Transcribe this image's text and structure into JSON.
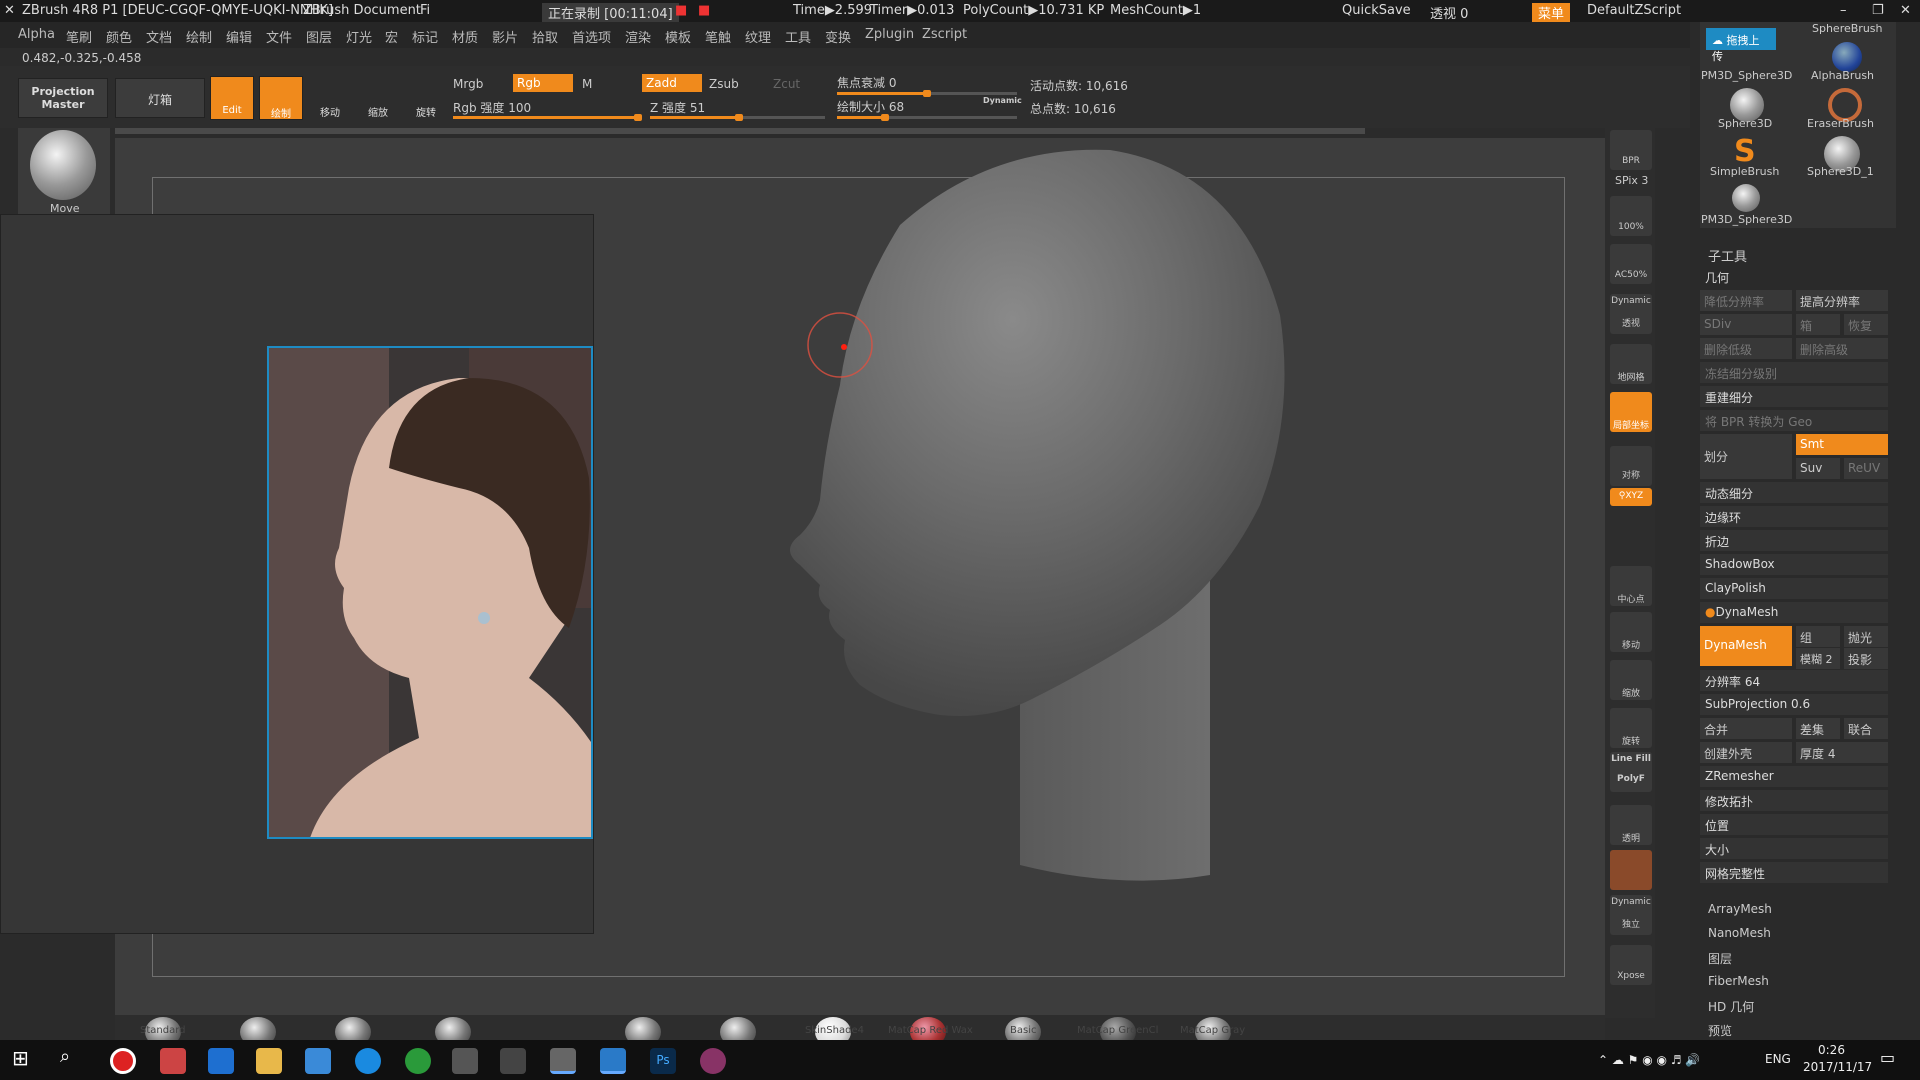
{
  "titlebar": {
    "app_title": "ZBrush 4R8 P1 [DEUC-CGQF-QMYE-UQKI-NNHK]",
    "document": "ZBrush Document",
    "fi": "Fi",
    "recording": "正在录制 [00:11:04]",
    "time": "Time▶2.599",
    "timer": "Timer▶0.013",
    "polycount": "PolyCount▶10.731 KP",
    "meshcount": "MeshCount▶1",
    "quicksave": "QuickSave",
    "transparency": "透视  0",
    "menu": "菜单",
    "default_zscript": "DefaultZScript"
  },
  "menubar": [
    "Alpha",
    "笔刷",
    "颜色",
    "文档",
    "绘制",
    "编辑",
    "文件",
    "图层",
    "灯光",
    "宏",
    "标记",
    "材质",
    "影片",
    "拾取",
    "首选项",
    "渲染",
    "模板",
    "笔触",
    "纹理",
    "工具",
    "变换",
    "Zplugin",
    "Zscript"
  ],
  "coords": "0.482,-0.325,-0.458",
  "toolbar": {
    "projection_master": "Projection Master",
    "lightbox": "灯箱",
    "edit": "Edit",
    "draw": "绘制",
    "move": "移动",
    "scale": "缩放",
    "rotate": "旋转",
    "mrgb": "Mrgb",
    "rgb": "Rgb",
    "m": "M",
    "zadd": "Zadd",
    "zsub": "Zsub",
    "zcut": "Zcut",
    "rgb_intensity_label": "Rgb 强度 100",
    "rgb_intensity": 100,
    "z_intensity_label": "Z 强度 51",
    "z_intensity": 51,
    "focal_shift_label": "焦点衰减 0",
    "draw_size_label": "绘制大小 68",
    "dynamic": "Dynamic",
    "active_points": "活动点数: 10,616",
    "total_points": "总点数: 10,616"
  },
  "brush_thumb_label": "Move",
  "right_shelf": {
    "bpr": "BPR",
    "spix": "SPix 3",
    "zoom100": "100%",
    "ac50": "AC50%",
    "dynamic": "Dynamic",
    "persp": "透视",
    "floor": "地网格",
    "local": "局部坐标",
    "sym": "对称",
    "xyz": "⚲XYZ",
    "frame": "中心点",
    "move": "移动",
    "zoom": "缩放",
    "rotate": "旋转",
    "linefill": "Line Fill",
    "polyf": "PolyF",
    "transp": "透明",
    "ghost": "",
    "dynamic2": "Dynamic",
    "solo": "独立",
    "xpose": "Xpose"
  },
  "tool_panel": {
    "upload": "拖拽上传",
    "tools": [
      "PM3D_Sphere3D",
      "AlphaBrush",
      "Sphere3D",
      "EraserBrush",
      "SimpleBrush",
      "Sphere3D_1",
      "PM3D_Sphere3D"
    ],
    "spherebrush": "SphereBrush",
    "subtool": "子工具",
    "geometry": "几何",
    "lower_res": "降低分辨率",
    "higher_res": "提高分辨率",
    "sdiv": "SDiv",
    "cage": "箱",
    "restore": "恢复",
    "del_lower": "删除低级",
    "del_higher": "删除高级",
    "freeze": "冻结细分级别",
    "reconstruct": "重建细分",
    "bpr_to_geo": "将 BPR 转换为 Geo",
    "divide": "划分",
    "smt": "Smt",
    "suv": "Suv",
    "reuv": "ReUV",
    "dynamic_subdiv": "动态细分",
    "edgeloop": "边缘环",
    "crease": "折边",
    "shadowbox": "ShadowBox",
    "claypolish": "ClayPolish",
    "dynamesh_header": "DynaMesh",
    "dynamesh_btn": "DynaMesh",
    "group": "组",
    "polish": "抛光",
    "blur": "模糊 2",
    "project": "投影",
    "resolution": "分辨率 64",
    "subprojection": "SubProjection 0.6",
    "merge": "合并",
    "difference": "差集",
    "union": "联合",
    "create_shell": "创建外壳",
    "thickness": "厚度 4",
    "zremesher": "ZRemesher",
    "modify_topo": "修改拓扑",
    "position": "位置",
    "size": "大小",
    "mesh_integrity": "网格完整性",
    "arraymesh": "ArrayMesh",
    "nanomesh": "NanoMesh",
    "layers": "图层",
    "fibermesh": "FiberMesh",
    "hd_geometry": "HD 几何",
    "preview": "预览"
  },
  "materials": [
    "Standard",
    "",
    "",
    "",
    "",
    "",
    "",
    "SkinShade4",
    "MatCap Red Wax",
    "Basic",
    "MatCap GreenCl",
    "MatCap Gray"
  ],
  "taskbar": {
    "lang": "ENG",
    "time": "0:26",
    "date": "2017/11/17"
  }
}
